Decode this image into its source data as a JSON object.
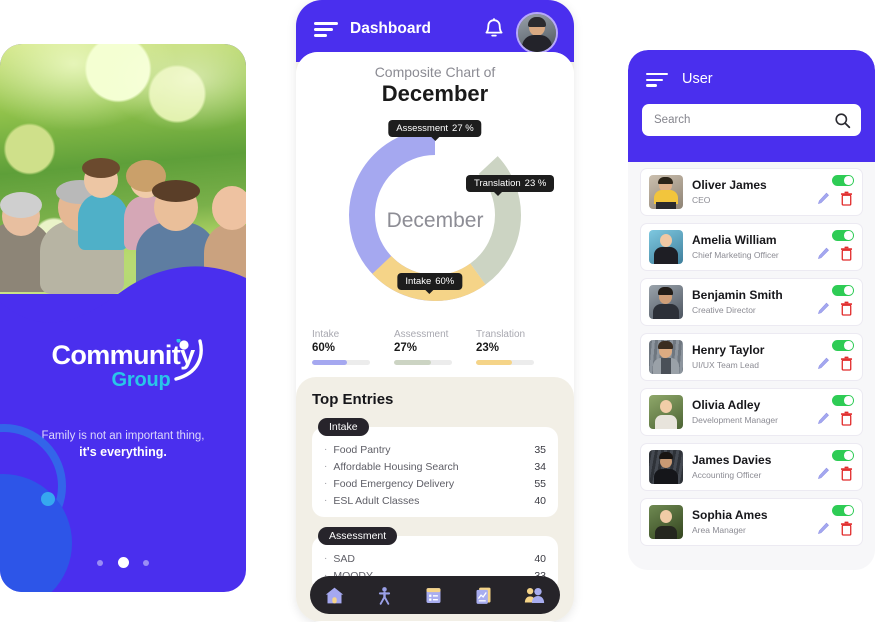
{
  "left_panel": {
    "photo_alt": "family-photo",
    "logo_primary": "Community",
    "logo_secondary": "Group",
    "tagline_line1": "Family is not an important thing,",
    "tagline_line2": "it's everything.",
    "pager_dots": 3,
    "pager_active_index": 1,
    "colors": {
      "brand_purple": "#4a2fee",
      "accent_cyan": "#29c6e8",
      "deep_blue": "#2d55e8"
    }
  },
  "dashboard": {
    "header": {
      "title": "Dashboard",
      "menu_icon": "hamburger-icon",
      "bell_icon": "bell-icon",
      "avatar_icon": "user-avatar"
    },
    "chart_title_small": "Composite Chart of",
    "chart_title_large": "December",
    "donut_center": "December",
    "tags": [
      {
        "label": "Assessment",
        "value": "27 %"
      },
      {
        "label": "Translation",
        "value": "23 %"
      },
      {
        "label": "Intake",
        "value": "60%"
      }
    ],
    "legend": [
      {
        "name": "Intake",
        "value": "60%",
        "pct": 60,
        "color": "#a5a8f0"
      },
      {
        "name": "Assessment",
        "value": "27%",
        "pct": 27,
        "color": "#ccd4c3"
      },
      {
        "name": "Translation",
        "value": "23%",
        "pct": 23,
        "color": "#f5d488"
      }
    ],
    "entries_title": "Top Entries",
    "entry_groups": [
      {
        "chip": "Intake",
        "rows": [
          {
            "name": "Food Pantry",
            "value": "35"
          },
          {
            "name": "Affordable Housing Search",
            "value": "34"
          },
          {
            "name": "Food Emergency Delivery",
            "value": "55"
          },
          {
            "name": "ESL Adult Classes",
            "value": "40"
          }
        ]
      },
      {
        "chip": "Assessment",
        "rows": [
          {
            "name": "SAD",
            "value": "40"
          },
          {
            "name": "MOODY",
            "value": "33"
          }
        ]
      }
    ],
    "tabbar": [
      {
        "icon": "home-icon",
        "active": true
      },
      {
        "icon": "person-icon",
        "active": false
      },
      {
        "icon": "clipboard-list-icon",
        "active": false
      },
      {
        "icon": "report-chart-icon",
        "active": false
      },
      {
        "icon": "users-group-icon",
        "active": false
      }
    ]
  },
  "chart_data": {
    "type": "pie",
    "title": "Composite Chart of December",
    "center_label": "December",
    "categories": [
      "Intake",
      "Assessment",
      "Translation"
    ],
    "values": [
      60,
      27,
      23
    ],
    "unit": "%",
    "colors": [
      "#a5a8f0",
      "#ccd4c3",
      "#f5d488"
    ],
    "legend_position": "bottom",
    "annotations": [
      {
        "label": "Assessment",
        "text": "Assessment  27 %"
      },
      {
        "label": "Translation",
        "text": "Translation  23 %"
      },
      {
        "label": "Intake",
        "text": "Intake  60%"
      }
    ]
  },
  "user_panel": {
    "menu_icon": "hamburger-icon",
    "title": "User",
    "search_placeholder": "Search",
    "search_value": "",
    "search_icon": "search-icon",
    "row_actions": {
      "toggle": "status-toggle",
      "edit": "edit-pencil-icon",
      "delete": "trash-icon"
    },
    "users": [
      {
        "name": "Oliver James",
        "role": "CEO",
        "enabled": true,
        "hue": 38,
        "sat": 72,
        "light": 50
      },
      {
        "name": "Amelia William",
        "role": "Chief Marketing Officer",
        "enabled": true,
        "hue": 196,
        "sat": 45,
        "light": 52
      },
      {
        "name": "Benjamin Smith",
        "role": "Creative Director",
        "enabled": true,
        "hue": 210,
        "sat": 14,
        "light": 40
      },
      {
        "name": "Henry Taylor",
        "role": "UI/UX Team Lead",
        "enabled": true,
        "hue": 205,
        "sat": 10,
        "light": 46
      },
      {
        "name": "Olivia Adley",
        "role": "Development Manager",
        "enabled": true,
        "hue": 95,
        "sat": 26,
        "light": 44
      },
      {
        "name": "James Davies",
        "role": "Accounting Officer",
        "enabled": true,
        "hue": 215,
        "sat": 8,
        "light": 30
      },
      {
        "name": "Sophia Ames",
        "role": "Area Manager",
        "enabled": true,
        "hue": 110,
        "sat": 30,
        "light": 38
      }
    ]
  }
}
